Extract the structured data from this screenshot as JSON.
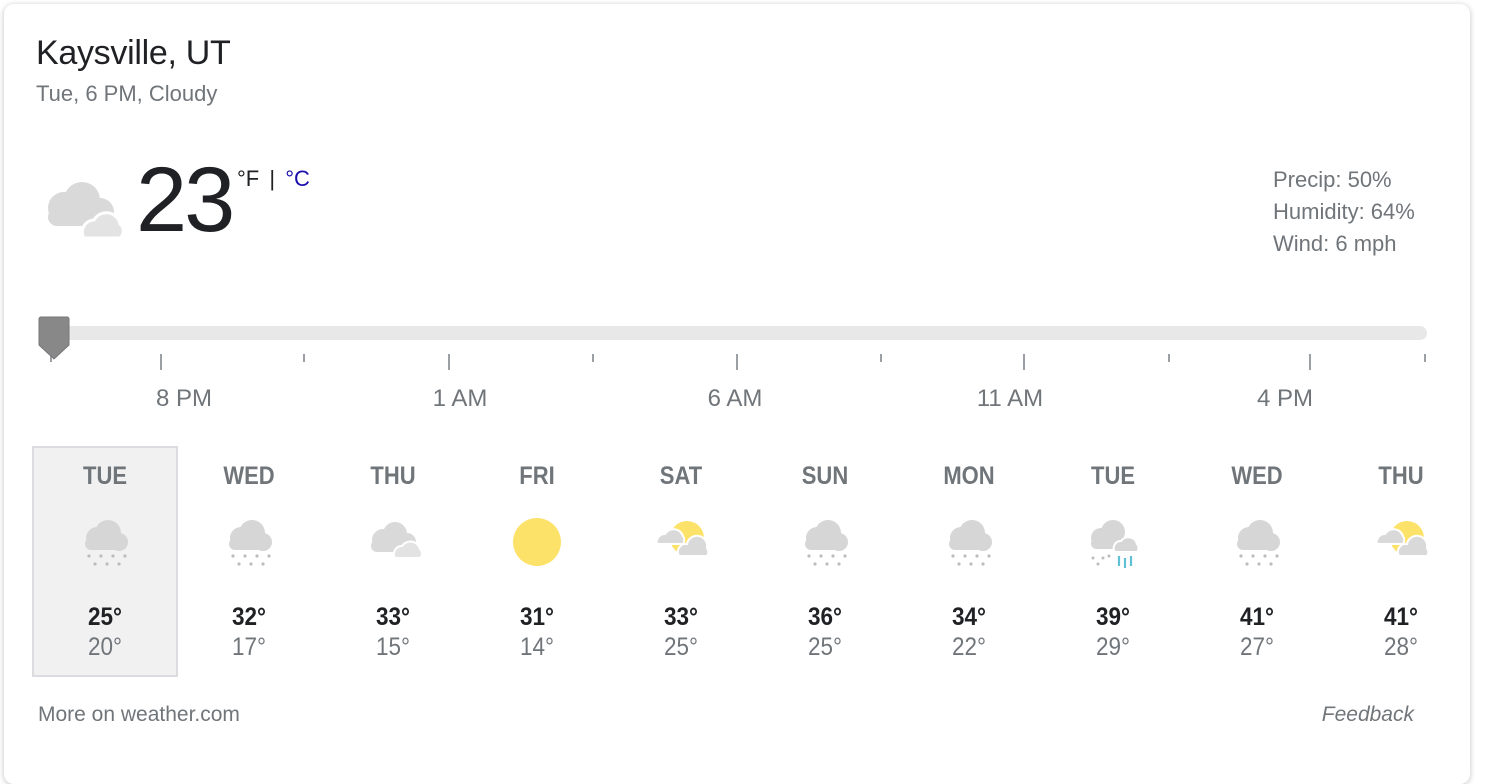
{
  "header": {
    "location": "Kaysville, UT",
    "subtitle": "Tue, 6 PM, Cloudy"
  },
  "current": {
    "temperature": "23",
    "unit_f": "°F",
    "unit_separator": "|",
    "unit_c": "°C",
    "icon": "cloudy-icon",
    "precip": "Precip: 50%",
    "humidity": "Humidity: 64%",
    "wind": "Wind: 6 mph"
  },
  "timeline": {
    "labels": [
      "8 PM",
      "1 AM",
      "6 AM",
      "11 AM",
      "4 PM"
    ],
    "position": 0
  },
  "forecast": [
    {
      "day": "TUE",
      "high": "25°",
      "low": "20°",
      "icon": "snow-icon",
      "selected": true
    },
    {
      "day": "WED",
      "high": "32°",
      "low": "17°",
      "icon": "snow-icon"
    },
    {
      "day": "THU",
      "high": "33°",
      "low": "15°",
      "icon": "cloudy-icon"
    },
    {
      "day": "FRI",
      "high": "31°",
      "low": "14°",
      "icon": "sunny-icon"
    },
    {
      "day": "SAT",
      "high": "33°",
      "low": "25°",
      "icon": "partly-cloudy-icon"
    },
    {
      "day": "SUN",
      "high": "36°",
      "low": "25°",
      "icon": "snow-icon"
    },
    {
      "day": "MON",
      "high": "34°",
      "low": "22°",
      "icon": "snow-icon"
    },
    {
      "day": "TUE",
      "high": "39°",
      "low": "29°",
      "icon": "rain-snow-icon"
    },
    {
      "day": "WED",
      "high": "41°",
      "low": "27°",
      "icon": "snow-icon"
    },
    {
      "day": "THU",
      "high": "41°",
      "low": "28°",
      "icon": "partly-cloudy-icon"
    }
  ],
  "footer": {
    "more_link": "More on weather.com",
    "feedback": "Feedback"
  },
  "colors": {
    "accent_link": "#1a0dab",
    "cloud": "#d6d6d6",
    "sun": "#fde26a",
    "rain": "#5ec2d4"
  }
}
